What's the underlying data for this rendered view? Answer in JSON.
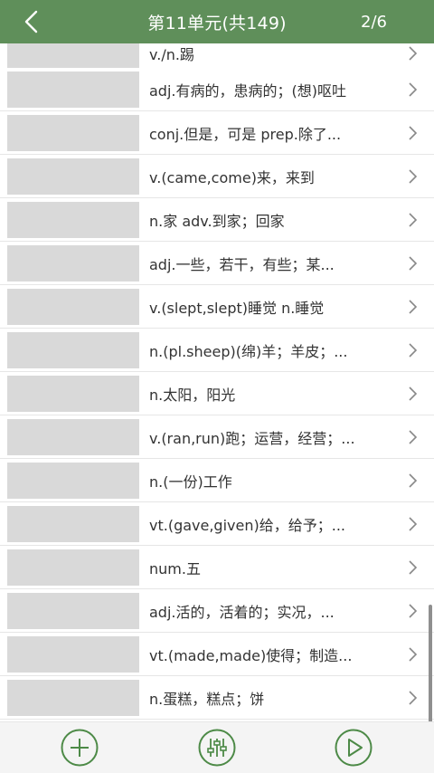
{
  "header": {
    "title": "第11单元(共149)",
    "page_count": "2/6"
  },
  "list": {
    "items": [
      {
        "meaning": "v./n.踢"
      },
      {
        "meaning": "adj.有病的，患病的；(想)呕吐"
      },
      {
        "meaning": "conj.但是，可是 prep.除了..."
      },
      {
        "meaning": "v.(came,come)来，来到"
      },
      {
        "meaning": "n.家 adv.到家；回家"
      },
      {
        "meaning": "adj.一些，若干，有些；某..."
      },
      {
        "meaning": "v.(slept,slept)睡觉 n.睡觉"
      },
      {
        "meaning": "n.(pl.sheep)(绵)羊；羊皮；..."
      },
      {
        "meaning": "n.太阳，阳光"
      },
      {
        "meaning": "v.(ran,run)跑；运营，经营；..."
      },
      {
        "meaning": "n.(一份)工作"
      },
      {
        "meaning": "vt.(gave,given)给，给予；..."
      },
      {
        "meaning": "num.五"
      },
      {
        "meaning": "adj.活的，活着的；实况，..."
      },
      {
        "meaning": "vt.(made,made)使得；制造..."
      },
      {
        "meaning": "n.蛋糕，糕点；饼"
      }
    ]
  },
  "icons": {
    "back": "chevron-left-icon",
    "row_arrow": "chevron-right-icon",
    "add": "plus-circle-icon",
    "settings": "sliders-icon",
    "play": "play-circle-icon"
  },
  "colors": {
    "header_bg": "#5f8f5a",
    "accent": "#4d8a47"
  }
}
